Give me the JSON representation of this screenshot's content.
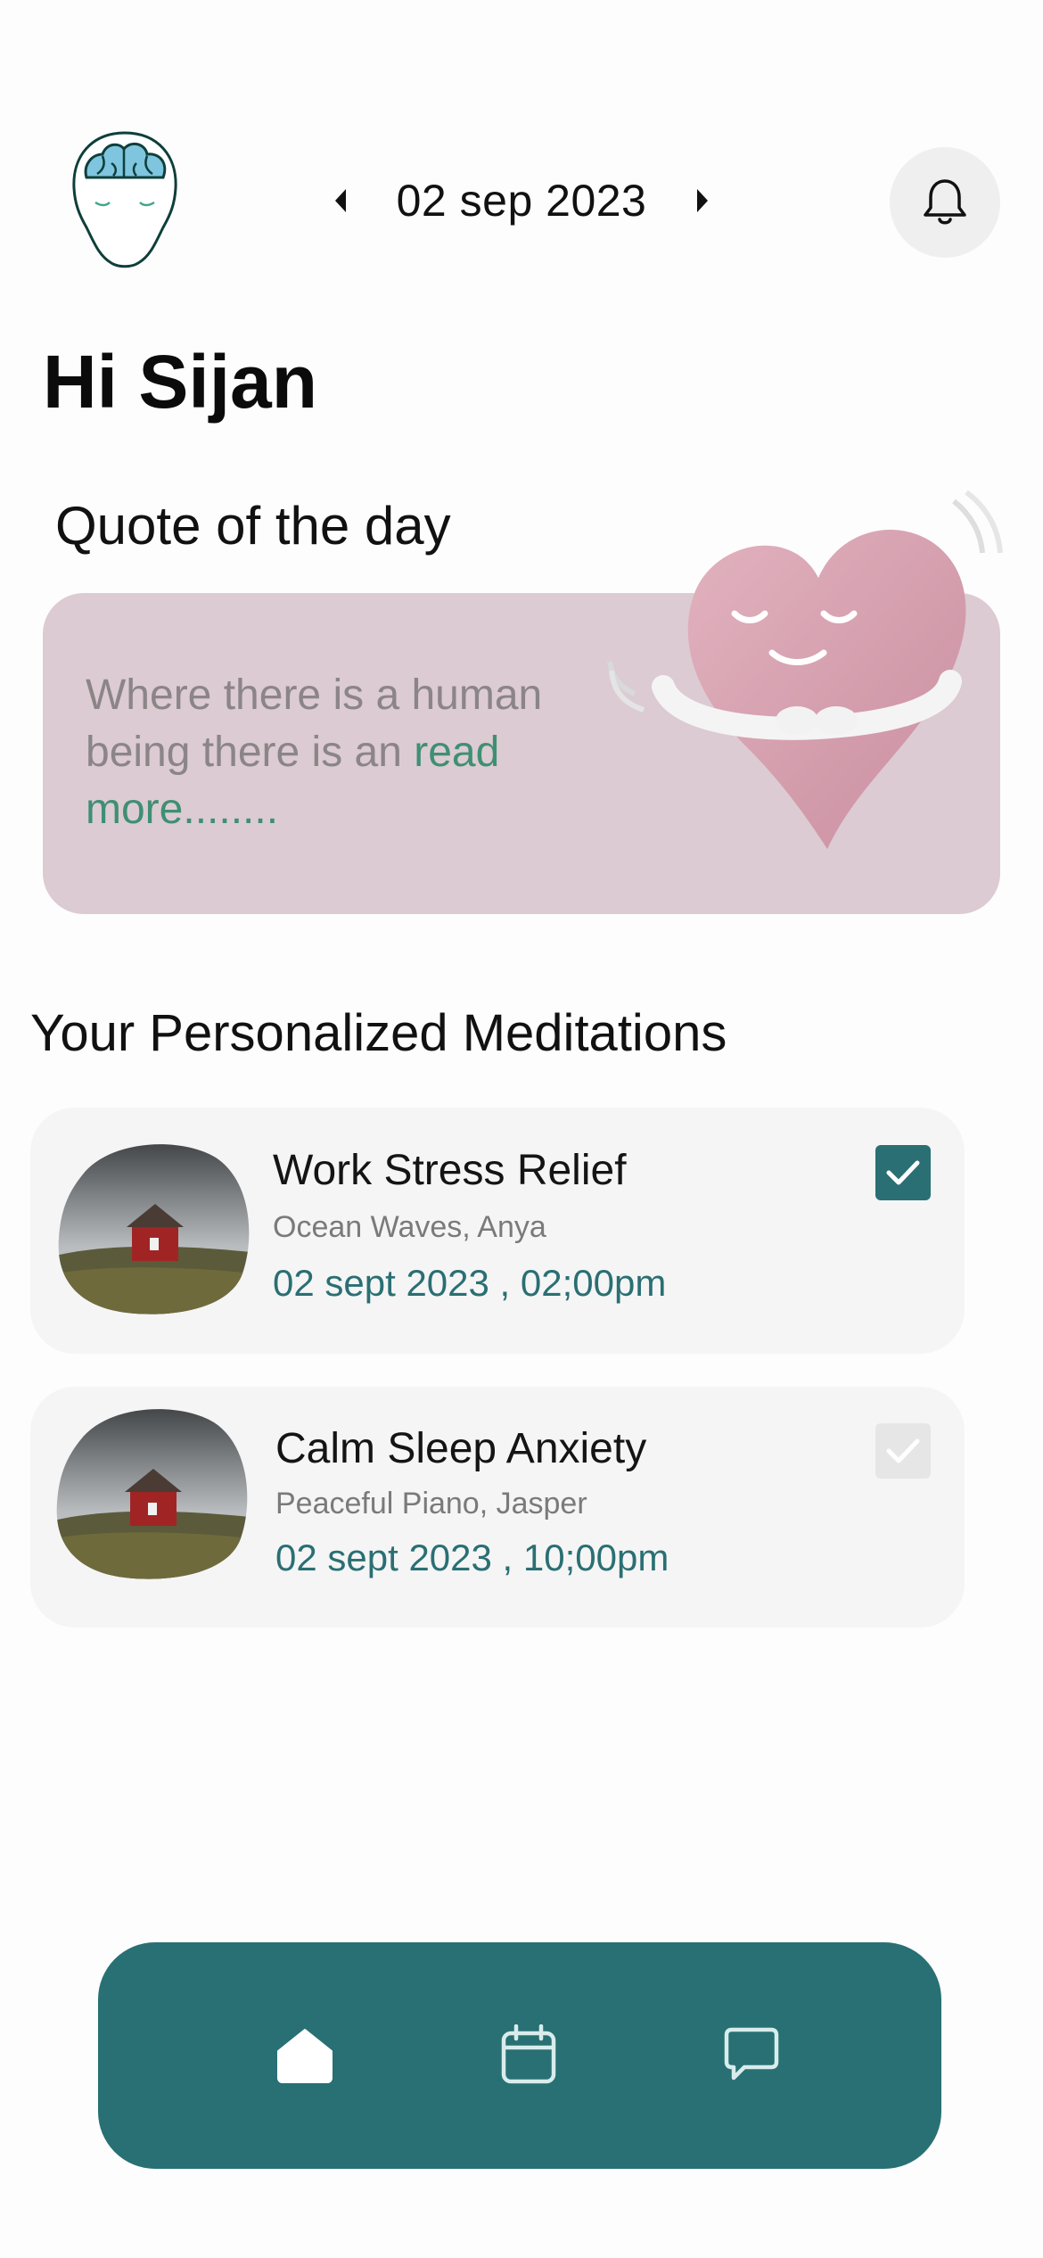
{
  "header": {
    "date": "02 sep 2023",
    "prev_icon": "caret-left-icon",
    "next_icon": "caret-right-icon",
    "notification_icon": "bell-icon",
    "logo_icon": "brain-head-icon"
  },
  "greeting": "Hi Sijan",
  "quote": {
    "title": "Quote of the day",
    "text": "Where there is a human being there is an ",
    "read_more": "read more........",
    "illustration": "hugging-heart-illustration"
  },
  "meditations": {
    "title": "Your Personalized Meditations",
    "items": [
      {
        "title": "Work Stress Relief",
        "subtitle": "Ocean Waves, Anya",
        "time": "02 sept 2023 , 02;00pm",
        "checked": true
      },
      {
        "title": "Calm Sleep Anxiety",
        "subtitle": "Peaceful Piano, Jasper",
        "time": "02 sept 2023 , 10;00pm",
        "checked": false
      }
    ]
  },
  "bottom_nav": {
    "items": [
      "home-icon",
      "calendar-icon",
      "chat-icon"
    ],
    "active": "home-icon"
  },
  "colors": {
    "accent": "#287074",
    "quote_card": "#dccbd2",
    "read_more": "#3f8f73",
    "checked": "#2a6f73",
    "unchecked": "#e6e6e6"
  }
}
